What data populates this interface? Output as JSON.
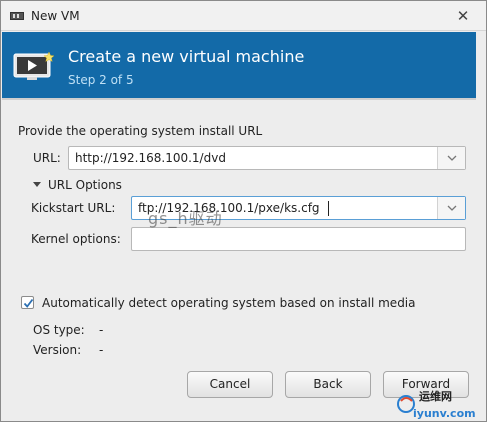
{
  "window": {
    "title": "New VM",
    "close_glyph": "✕"
  },
  "header": {
    "icon": "vm-monitor-icon",
    "title": "Create a new virtual machine",
    "step": "Step 2 of 5",
    "background_color": "#136aa8"
  },
  "form": {
    "section_label": "Provide the operating system install URL",
    "url_label": "URL:",
    "url_value": "http://192.168.100.1/dvd",
    "url_options_label": "URL Options",
    "kickstart_label": "Kickstart URL:",
    "kickstart_value": "ftp://192.168.100.1/pxe/ks.cfg",
    "kernel_label": "Kernel options:",
    "kernel_value": "",
    "autodetect_label": "Automatically detect operating system based on install media",
    "autodetect_checked": true,
    "os_type_label": "OS type:",
    "os_type_value": "-",
    "version_label": "Version:",
    "version_value": "-"
  },
  "buttons": {
    "cancel": "Cancel",
    "back": "Back",
    "forward": "Forward"
  },
  "watermark": {
    "overlay_text": "gs_h驱动",
    "logo_text": "iyunv.com",
    "logo_cn": "运维网"
  }
}
